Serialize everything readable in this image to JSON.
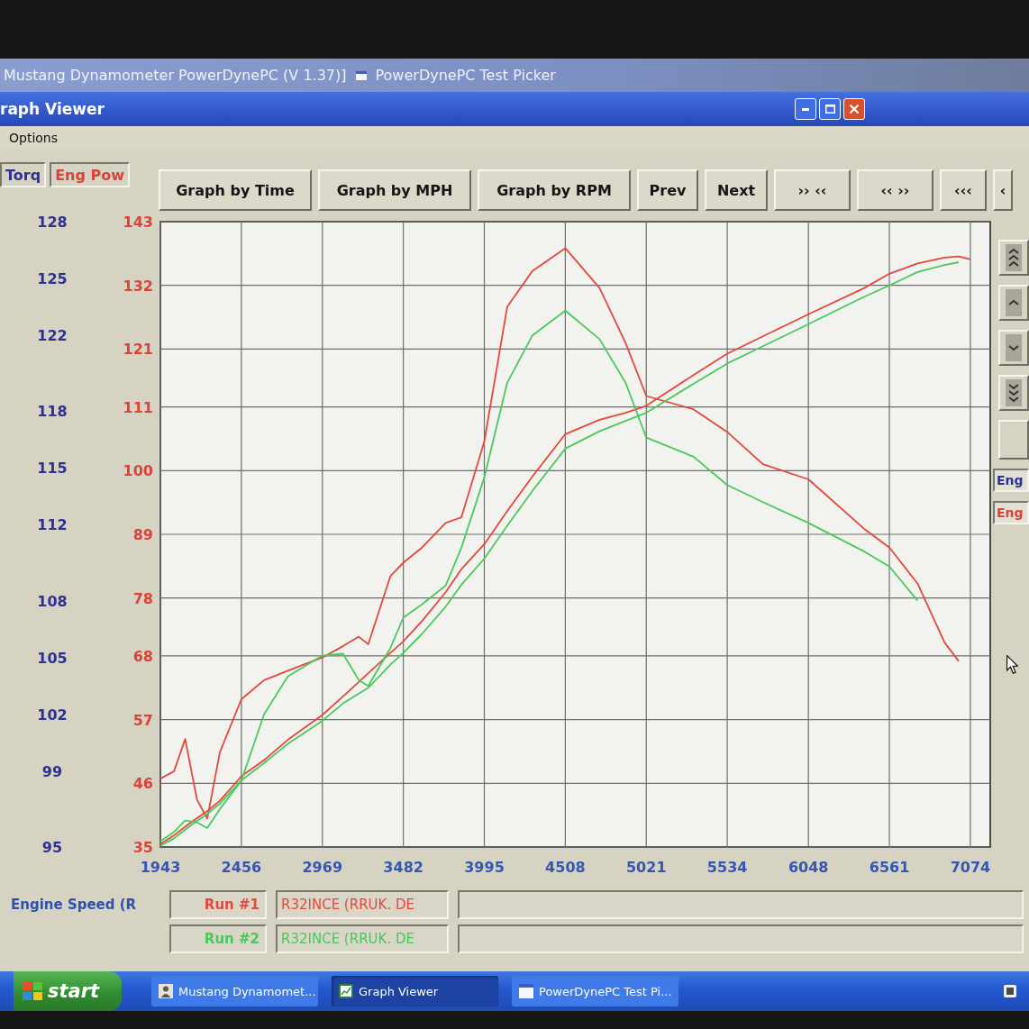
{
  "back_windows": [
    {
      "title": "Mustang Dynamometer PowerDynePC (V 1.37)]"
    },
    {
      "title": "PowerDynePC Test Picker"
    }
  ],
  "window": {
    "title": "raph Viewer"
  },
  "menu": [
    "Options"
  ],
  "axis_headers": [
    {
      "label": "Torq",
      "color": "#2c3192"
    },
    {
      "label": "Eng Pow",
      "color": "#d9443a"
    }
  ],
  "toolbar": [
    "Graph by Time",
    "Graph by MPH",
    "Graph by RPM",
    "Prev",
    "Next",
    "›› ‹‹",
    "‹‹ ››",
    "‹‹‹",
    "‹"
  ],
  "graph": {
    "chart_data": {
      "type": "line",
      "grid": true,
      "x": [
        1943,
        2030,
        2100,
        2175,
        2240,
        2320,
        2456,
        2600,
        2750,
        2969,
        3100,
        3200,
        3260,
        3400,
        3482,
        3600,
        3750,
        3850,
        3995,
        4140,
        4300,
        4508,
        4725,
        4890,
        5021,
        5320,
        5534,
        5760,
        6048,
        6400,
        6561,
        6740,
        6910,
        7000,
        7074
      ],
      "xlim": [
        1943,
        7200
      ],
      "xticks": [
        1943,
        2456,
        2969,
        3482,
        3995,
        4508,
        5021,
        5534,
        6048,
        6561,
        7074
      ],
      "ylim": [
        35,
        143
      ],
      "yticks": [
        35,
        46,
        57,
        68,
        78,
        89,
        100,
        111,
        121,
        132,
        143
      ],
      "y2lim": [
        95,
        128
      ],
      "y2ticks": [
        95,
        99,
        102,
        105,
        108,
        112,
        115,
        118,
        122,
        125,
        128
      ],
      "series": [
        {
          "axis": "y2",
          "color": "#e2483c",
          "values": [
            98.6,
            99.0,
            100.7,
            97.5,
            96.5,
            100.0,
            102.8,
            103.8,
            104.3,
            105.0,
            105.6,
            106.1,
            105.7,
            109.3,
            110.0,
            110.8,
            112.1,
            112.4,
            116.4,
            123.5,
            125.4,
            126.6,
            124.5,
            121.6,
            118.8,
            118.1,
            116.9,
            115.2,
            114.4,
            111.8,
            110.8,
            108.9,
            105.8,
            104.8,
            null
          ]
        },
        {
          "axis": "y",
          "color": "#e2483c",
          "values": [
            35.5,
            37,
            38.5,
            40,
            41.2,
            43,
            47.2,
            50,
            53.5,
            57.8,
            61,
            63.5,
            65,
            68.5,
            70.5,
            74,
            79,
            83,
            87.3,
            93,
            99,
            106.3,
            108.8,
            110,
            111.2,
            116.5,
            120.2,
            123.2,
            127,
            131.5,
            134,
            135.8,
            136.8,
            137,
            136.5
          ]
        },
        {
          "axis": "y2",
          "color": "#48c95c",
          "values": [
            95.3,
            95.8,
            96.4,
            96.3,
            96.0,
            97.0,
            98.5,
            102.0,
            104.0,
            105.1,
            105.2,
            103.8,
            103.5,
            105.5,
            107.1,
            107.8,
            108.8,
            110.8,
            114.5,
            119.5,
            122.0,
            123.3,
            121.8,
            119.5,
            116.6,
            115.6,
            114.1,
            113.2,
            112.1,
            110.6,
            109.8,
            108.0,
            null,
            null,
            null
          ]
        },
        {
          "axis": "y",
          "color": "#48c95c",
          "values": [
            35.2,
            36.5,
            38,
            39.5,
            40.7,
            42.5,
            46.5,
            49.5,
            52.8,
            56.8,
            59.8,
            61.5,
            62.5,
            66.5,
            68.5,
            71.8,
            76.5,
            80.3,
            84.8,
            90.5,
            96.5,
            103.8,
            106.8,
            108.6,
            110,
            115,
            118.5,
            121.5,
            125.3,
            130,
            132,
            134.3,
            135.5,
            136,
            null
          ]
        }
      ]
    }
  },
  "side_panel": {
    "fields": [
      {
        "label": "Eng",
        "color": "#2c3192"
      },
      {
        "label": "Eng",
        "color": "#d9443a"
      }
    ]
  },
  "legend": {
    "axis_title": "Engine Speed (R",
    "runs": [
      {
        "label": "Run #1",
        "file": "R32INCE (RRUK. DE",
        "color": "#e2483c"
      },
      {
        "label": "Run #2",
        "file": "R32INCE (RRUK. DE",
        "color": "#48c95c"
      }
    ]
  },
  "taskbar": {
    "start": "start",
    "tasks": [
      {
        "label": "Mustang Dynamomet...",
        "selected": false
      },
      {
        "label": "Graph Viewer",
        "selected": true
      },
      {
        "label": "PowerDynePC Test Pi...",
        "selected": false
      }
    ]
  }
}
